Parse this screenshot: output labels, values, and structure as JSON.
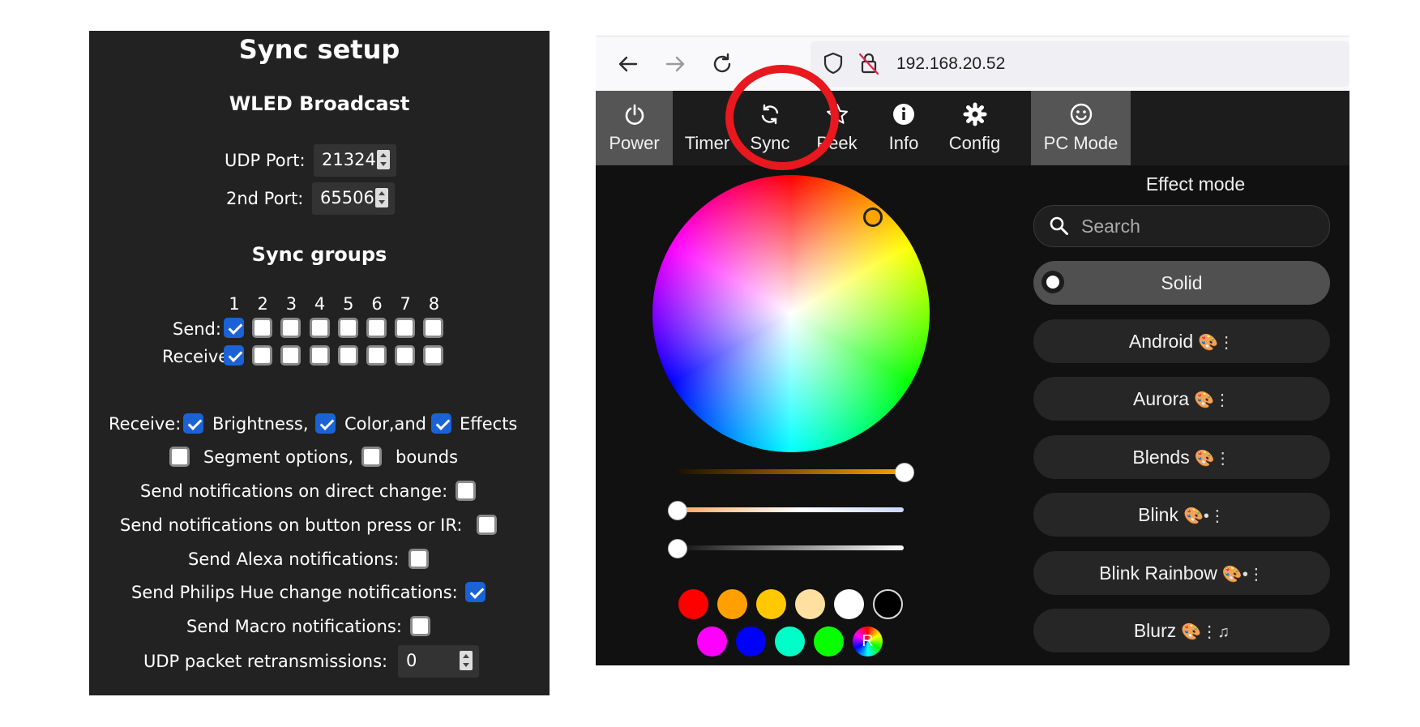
{
  "sync": {
    "title": "Sync setup",
    "broadcast_heading": "WLED Broadcast",
    "udp_port_label": "UDP Port:",
    "udp_port_value": "21324",
    "second_port_label": "2nd Port:",
    "second_port_value": "65506",
    "groups_heading": "Sync groups",
    "group_numbers": [
      "1",
      "2",
      "3",
      "4",
      "5",
      "6",
      "7",
      "8"
    ],
    "send_label": "Send:",
    "receive_label": "Receive:",
    "send_groups": [
      true,
      false,
      false,
      false,
      false,
      false,
      false,
      false
    ],
    "receive_groups": [
      true,
      false,
      false,
      false,
      false,
      false,
      false,
      false
    ],
    "receive_prefix": "Receive:",
    "brightness_label": "Brightness,",
    "brightness_checked": true,
    "color_label": "Color,and",
    "color_checked": true,
    "effects_label": "Effects",
    "effects_checked": true,
    "segment_options_label": "Segment options,",
    "segment_options_checked": false,
    "bounds_label": "bounds",
    "bounds_checked": false,
    "direct_change_label": "Send notifications on direct change:",
    "direct_change_checked": false,
    "button_press_label": "Send notifications on button press or IR:",
    "button_press_checked": false,
    "alexa_label": "Send Alexa notifications:",
    "alexa_checked": false,
    "hue_label": "Send Philips Hue change notifications:",
    "hue_checked": true,
    "macro_label": "Send Macro notifications:",
    "macro_checked": false,
    "retrans_label": "UDP packet retransmissions:",
    "retrans_value": "0"
  },
  "browser": {
    "url": "192.168.20.52",
    "icons": [
      "back-arrow-icon",
      "forward-arrow-icon",
      "reload-icon",
      "shield-icon",
      "lock-slash-icon"
    ]
  },
  "tabs": [
    {
      "label": "Power",
      "icon": "power-icon",
      "active": true
    },
    {
      "label": "Timer",
      "icon": "moon-icon",
      "active": false
    },
    {
      "label": "Sync",
      "icon": "sync-icon",
      "active": false
    },
    {
      "label": "Peek",
      "icon": "star-icon",
      "active": false
    },
    {
      "label": "Info",
      "icon": "info-icon",
      "active": false
    },
    {
      "label": "Config",
      "icon": "gear-icon",
      "active": false
    },
    {
      "label": "PC Mode",
      "icon": "smiley-icon",
      "active": true
    }
  ],
  "color": {
    "brightness_level": 1.0,
    "white_balance_level": 0.0,
    "white_level": 0.0,
    "swatches_row1": [
      "#ff0000",
      "#ffa000",
      "#ffc800",
      "#ffe0a0",
      "#ffffff",
      "#000000"
    ],
    "swatches_row2": [
      "#ff00ff",
      "#0000ff",
      "#00ffc8",
      "#08ff00"
    ],
    "random_label": "R"
  },
  "effects": {
    "title": "Effect mode",
    "search_placeholder": "Search",
    "items": [
      {
        "name": "Solid",
        "selected": true,
        "tag": ""
      },
      {
        "name": "Android",
        "selected": false,
        "tag": "🎨⋮"
      },
      {
        "name": "Aurora",
        "selected": false,
        "tag": "🎨⋮"
      },
      {
        "name": "Blends",
        "selected": false,
        "tag": "🎨⋮"
      },
      {
        "name": "Blink",
        "selected": false,
        "tag": "🎨•⋮"
      },
      {
        "name": "Blink Rainbow",
        "selected": false,
        "tag": "🎨•⋮"
      },
      {
        "name": "Blurz",
        "selected": false,
        "tag": "🎨⋮♫"
      }
    ]
  },
  "annotation_color": "#e8181e"
}
